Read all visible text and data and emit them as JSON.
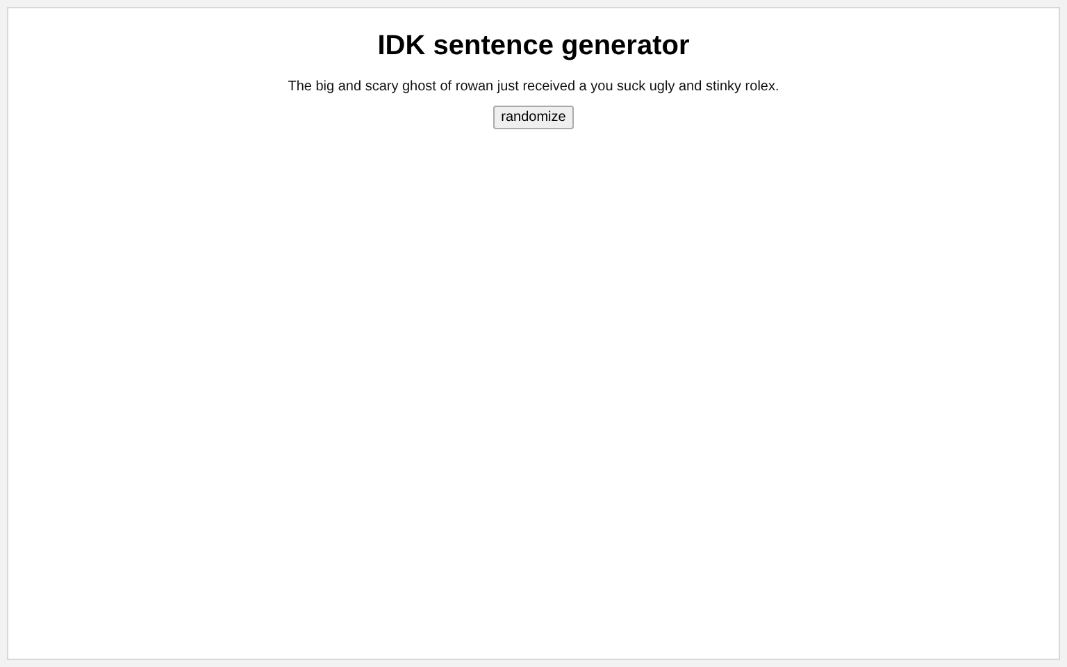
{
  "title": "IDK sentence generator",
  "sentence": "The big and scary ghost of rowan just received a you suck ugly and stinky rolex.",
  "button": "randomize"
}
